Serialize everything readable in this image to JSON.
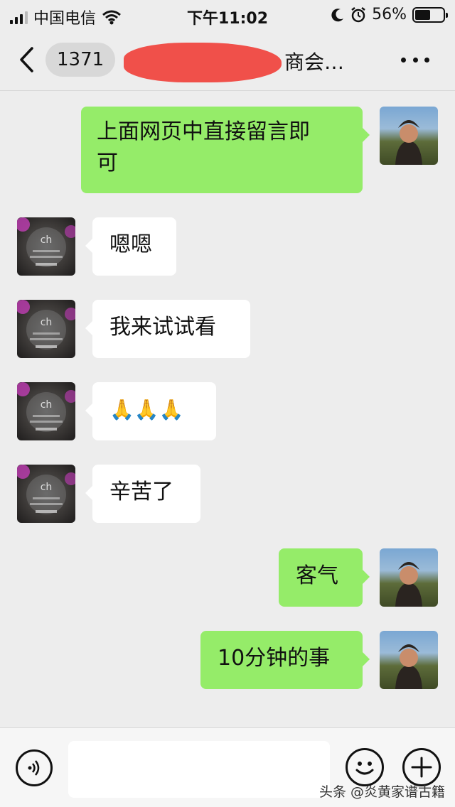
{
  "status_bar": {
    "carrier": "中国电信",
    "time": "下午11:02",
    "battery": "56%",
    "battery_level": 0.56
  },
  "nav": {
    "unread_count": "1371",
    "title": "商会…"
  },
  "messages": [
    {
      "side": "right",
      "text_line1": "上面网页中直接留言即",
      "text_line2": "可"
    },
    {
      "side": "left",
      "text": "嗯嗯"
    },
    {
      "side": "left",
      "text": "我来试试看"
    },
    {
      "side": "left",
      "text": "🙏🙏🙏"
    },
    {
      "side": "left",
      "text": "辛苦了"
    },
    {
      "side": "right",
      "text": "客气"
    },
    {
      "side": "right",
      "text": "10分钟的事"
    }
  ],
  "input_bar": {
    "placeholder": ""
  },
  "watermark": "头条 @炎黄家谱古籍",
  "colors": {
    "background": "#ededed",
    "outgoing_bubble": "#95ec69",
    "incoming_bubble": "#ffffff",
    "redaction": "#f0423c"
  }
}
